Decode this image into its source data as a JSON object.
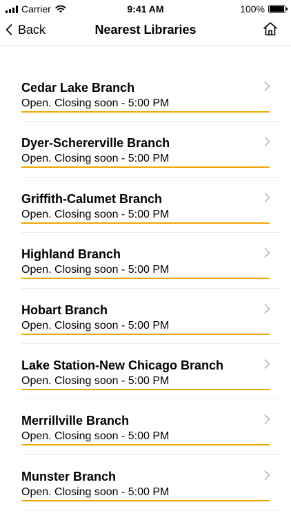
{
  "status_bar": {
    "carrier": "Carrier",
    "time": "9:41 AM",
    "battery": "100%"
  },
  "nav": {
    "back_label": "Back",
    "title": "Nearest Libraries"
  },
  "colors": {
    "accent_underline": "#f0a800",
    "chevron": "#b8b8b8"
  },
  "libraries": [
    {
      "name": "Cedar Lake Branch",
      "status": "Open. Closing soon - 5:00 PM"
    },
    {
      "name": "Dyer-Schererville Branch",
      "status": "Open. Closing soon - 5:00 PM"
    },
    {
      "name": "Griffith-Calumet Branch",
      "status": "Open. Closing soon - 5:00 PM"
    },
    {
      "name": "Highland Branch",
      "status": "Open. Closing soon - 5:00 PM"
    },
    {
      "name": "Hobart Branch",
      "status": "Open. Closing soon - 5:00 PM"
    },
    {
      "name": "Lake Station-New Chicago Branch",
      "status": "Open. Closing soon - 5:00 PM"
    },
    {
      "name": "Merrillville Branch",
      "status": "Open. Closing soon - 5:00 PM"
    },
    {
      "name": "Munster Branch",
      "status": "Open. Closing soon - 5:00 PM"
    }
  ]
}
